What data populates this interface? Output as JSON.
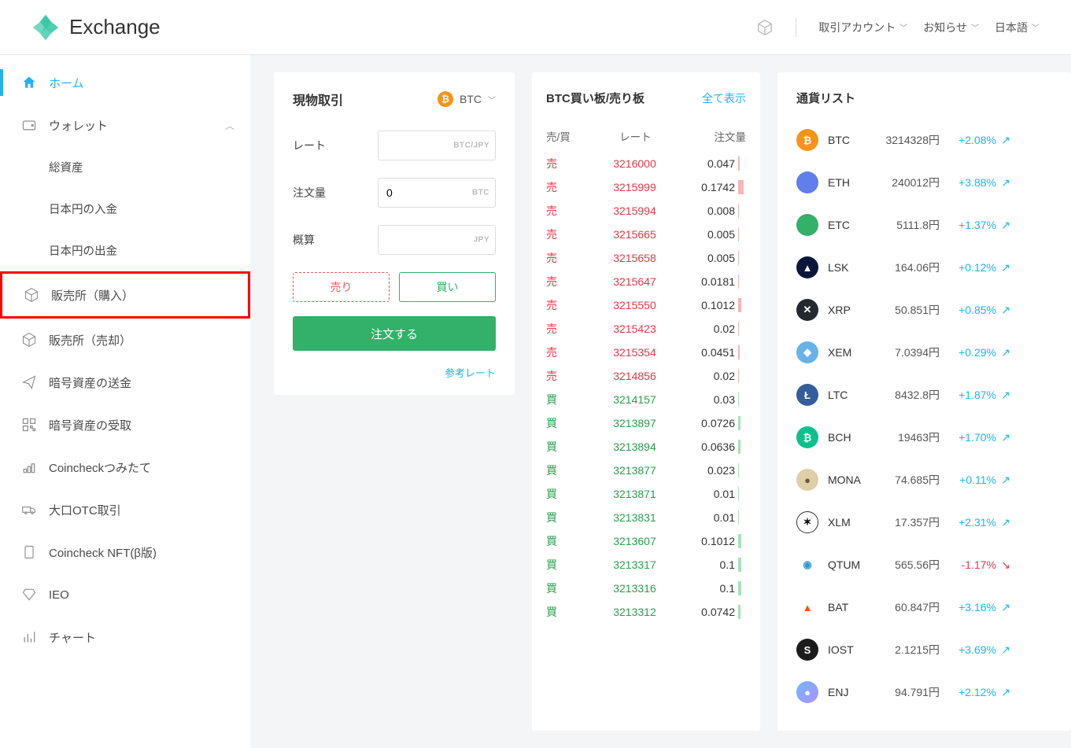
{
  "header": {
    "logo_text": "Exchange",
    "nav": {
      "account": "取引アカウント",
      "notice": "お知らせ",
      "lang": "日本語"
    }
  },
  "sidebar": {
    "home": "ホーム",
    "wallet": "ウォレット",
    "subs": {
      "total": "総資産",
      "deposit_jpy": "日本円の入金",
      "withdraw_jpy": "日本円の出金"
    },
    "buy_store": "販売所（購入）",
    "sell_store": "販売所（売却）",
    "send_crypto": "暗号資産の送金",
    "receive_crypto": "暗号資産の受取",
    "tsumitate": "Coincheckつみたて",
    "otc": "大口OTC取引",
    "nft": "Coincheck NFT(β版)",
    "ieo": "IEO",
    "chart": "チャート"
  },
  "trade": {
    "title": "現物取引",
    "currency": "BTC",
    "rate_label": "レート",
    "rate_unit": "BTC/JPY",
    "qty_label": "注文量",
    "qty_value": "0",
    "qty_unit": "BTC",
    "est_label": "概算",
    "est_unit": "JPY",
    "sell": "売り",
    "buy": "買い",
    "order": "注文する",
    "ref_rate": "参考レート"
  },
  "orderbook": {
    "title": "BTC買い板/売り板",
    "showall": "全て表示",
    "cols": {
      "side": "売/買",
      "rate": "レート",
      "qty": "注文量"
    },
    "sells": [
      {
        "rate": "3216000",
        "qty": "0.047",
        "bar": 18
      },
      {
        "rate": "3215999",
        "qty": "0.1742",
        "bar": 65
      },
      {
        "rate": "3215994",
        "qty": "0.008",
        "bar": 6
      },
      {
        "rate": "3215665",
        "qty": "0.005",
        "bar": 5
      },
      {
        "rate": "3215658",
        "qty": "0.005",
        "bar": 5
      },
      {
        "rate": "3215647",
        "qty": "0.0181",
        "bar": 10
      },
      {
        "rate": "3215550",
        "qty": "0.1012",
        "bar": 40
      },
      {
        "rate": "3215423",
        "qty": "0.02",
        "bar": 10
      },
      {
        "rate": "3215354",
        "qty": "0.0451",
        "bar": 18
      },
      {
        "rate": "3214856",
        "qty": "0.02",
        "bar": 10
      }
    ],
    "buys": [
      {
        "rate": "3214157",
        "qty": "0.03",
        "bar": 14
      },
      {
        "rate": "3213897",
        "qty": "0.0726",
        "bar": 30
      },
      {
        "rate": "3213894",
        "qty": "0.0636",
        "bar": 26
      },
      {
        "rate": "3213877",
        "qty": "0.023",
        "bar": 12
      },
      {
        "rate": "3213871",
        "qty": "0.01",
        "bar": 7
      },
      {
        "rate": "3213831",
        "qty": "0.01",
        "bar": 7
      },
      {
        "rate": "3213607",
        "qty": "0.1012",
        "bar": 40
      },
      {
        "rate": "3213317",
        "qty": "0.1",
        "bar": 40
      },
      {
        "rate": "3213316",
        "qty": "0.1",
        "bar": 40
      },
      {
        "rate": "3213312",
        "qty": "0.0742",
        "bar": 30
      }
    ],
    "sell_label": "売",
    "buy_label": "買"
  },
  "currencies": {
    "title": "通貨リスト",
    "items": [
      {
        "sym": "BTC",
        "price": "3214328円",
        "change": "+2.08%",
        "dir": "up",
        "color": "#f7931a",
        "glyph": "₿"
      },
      {
        "sym": "ETH",
        "price": "240012円",
        "change": "+3.88%",
        "dir": "up",
        "color": "#627eea",
        "glyph": "♦",
        "textcolor": "#627eea"
      },
      {
        "sym": "ETC",
        "price": "5111.8円",
        "change": "+1.37%",
        "dir": "up",
        "color": "#33b069",
        "glyph": "♦",
        "textcolor": "#33b069"
      },
      {
        "sym": "LSK",
        "price": "164.06円",
        "change": "+0.12%",
        "dir": "up",
        "color": "#0b163b",
        "glyph": "▲"
      },
      {
        "sym": "XRP",
        "price": "50.851円",
        "change": "+0.85%",
        "dir": "up",
        "color": "#23292f",
        "glyph": "✕"
      },
      {
        "sym": "XEM",
        "price": "7.0394円",
        "change": "+0.29%",
        "dir": "up",
        "color": "#67b2e8",
        "glyph": "◆"
      },
      {
        "sym": "LTC",
        "price": "8432.8円",
        "change": "+1.87%",
        "dir": "up",
        "color": "#345d9d",
        "glyph": "Ł"
      },
      {
        "sym": "BCH",
        "price": "19463円",
        "change": "+1.70%",
        "dir": "up",
        "color": "#0ac18e",
        "glyph": "₿"
      },
      {
        "sym": "MONA",
        "price": "74.685円",
        "change": "+0.11%",
        "dir": "up",
        "color": "#decfa9",
        "glyph": "●",
        "textcolor": "#6b5a3a"
      },
      {
        "sym": "XLM",
        "price": "17.357円",
        "change": "+2.31%",
        "dir": "up",
        "color": "#000000",
        "glyph": "✶",
        "textcolor": "#000",
        "bg": "#fff",
        "border": "1px solid #333"
      },
      {
        "sym": "QTUM",
        "price": "565.56円",
        "change": "-1.17%",
        "dir": "down",
        "color": "#2e9ad0",
        "glyph": "◉",
        "textcolor": "#2e9ad0",
        "bg": "#fff"
      },
      {
        "sym": "BAT",
        "price": "60.847円",
        "change": "+3.16%",
        "dir": "up",
        "color": "#ff5000",
        "glyph": "▲",
        "textcolor": "#ff5000",
        "bg": "#fff"
      },
      {
        "sym": "IOST",
        "price": "2.1215円",
        "change": "+3.69%",
        "dir": "up",
        "color": "#1c1c1c",
        "glyph": "S"
      },
      {
        "sym": "ENJ",
        "price": "94.791円",
        "change": "+2.12%",
        "dir": "up",
        "color": "#7866d5",
        "glyph": "●",
        "bg": "linear-gradient(135deg,#6fb8ff,#b08fff)"
      }
    ]
  }
}
